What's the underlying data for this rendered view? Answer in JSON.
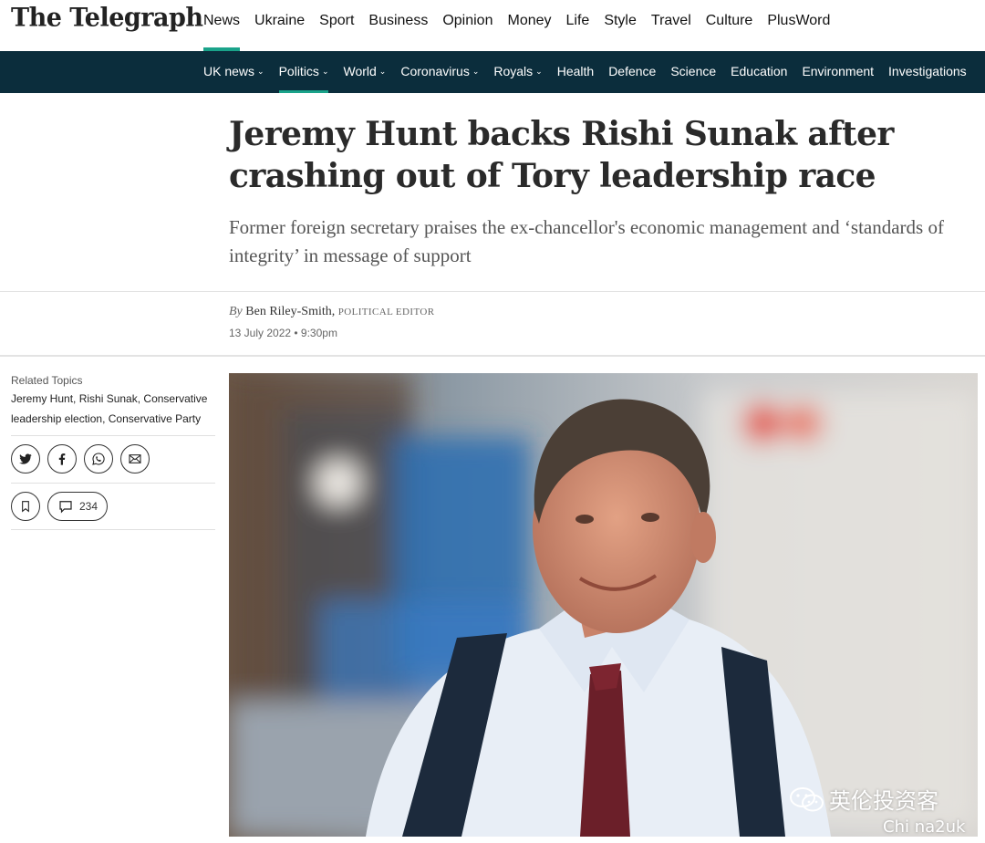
{
  "brand": {
    "logo_text": "The Telegraph"
  },
  "primary_nav": [
    "News",
    "Ukraine",
    "Sport",
    "Business",
    "Opinion",
    "Money",
    "Life",
    "Style",
    "Travel",
    "Culture",
    "PlusWord"
  ],
  "secondary_nav": [
    {
      "label": "UK news",
      "dropdown": true
    },
    {
      "label": "Politics",
      "dropdown": true,
      "active": true
    },
    {
      "label": "World",
      "dropdown": true
    },
    {
      "label": "Coronavirus",
      "dropdown": true
    },
    {
      "label": "Royals",
      "dropdown": true
    },
    {
      "label": "Health",
      "dropdown": false
    },
    {
      "label": "Defence",
      "dropdown": false
    },
    {
      "label": "Science",
      "dropdown": false
    },
    {
      "label": "Education",
      "dropdown": false
    },
    {
      "label": "Environment",
      "dropdown": false
    },
    {
      "label": "Investigations",
      "dropdown": false
    }
  ],
  "article": {
    "headline": "Jeremy Hunt backs Rishi Sunak after crashing out of Tory leadership race",
    "standfirst": "Former foreign secretary praises the ex-chancellor's economic management and ‘standards of integrity’ in message of support",
    "byline_prefix": "By",
    "author": "Ben Riley-Smith,",
    "author_role": "Political Editor",
    "date": "13 July 2022 • 9:30pm"
  },
  "sidebar": {
    "related_heading": "Related Topics",
    "related_topics": [
      "Jeremy Hunt,",
      "Rishi Sunak,",
      "Conservative leadership election,",
      "Conservative Party"
    ],
    "share_icons": [
      "twitter-icon",
      "facebook-icon",
      "whatsapp-icon",
      "email-icon"
    ],
    "comment_count": "234"
  },
  "watermark": {
    "line1": "英伦投资客",
    "line2": "Chi na2uk"
  },
  "colors": {
    "accent": "#1aa38a",
    "navy": "#0b2d3c"
  }
}
